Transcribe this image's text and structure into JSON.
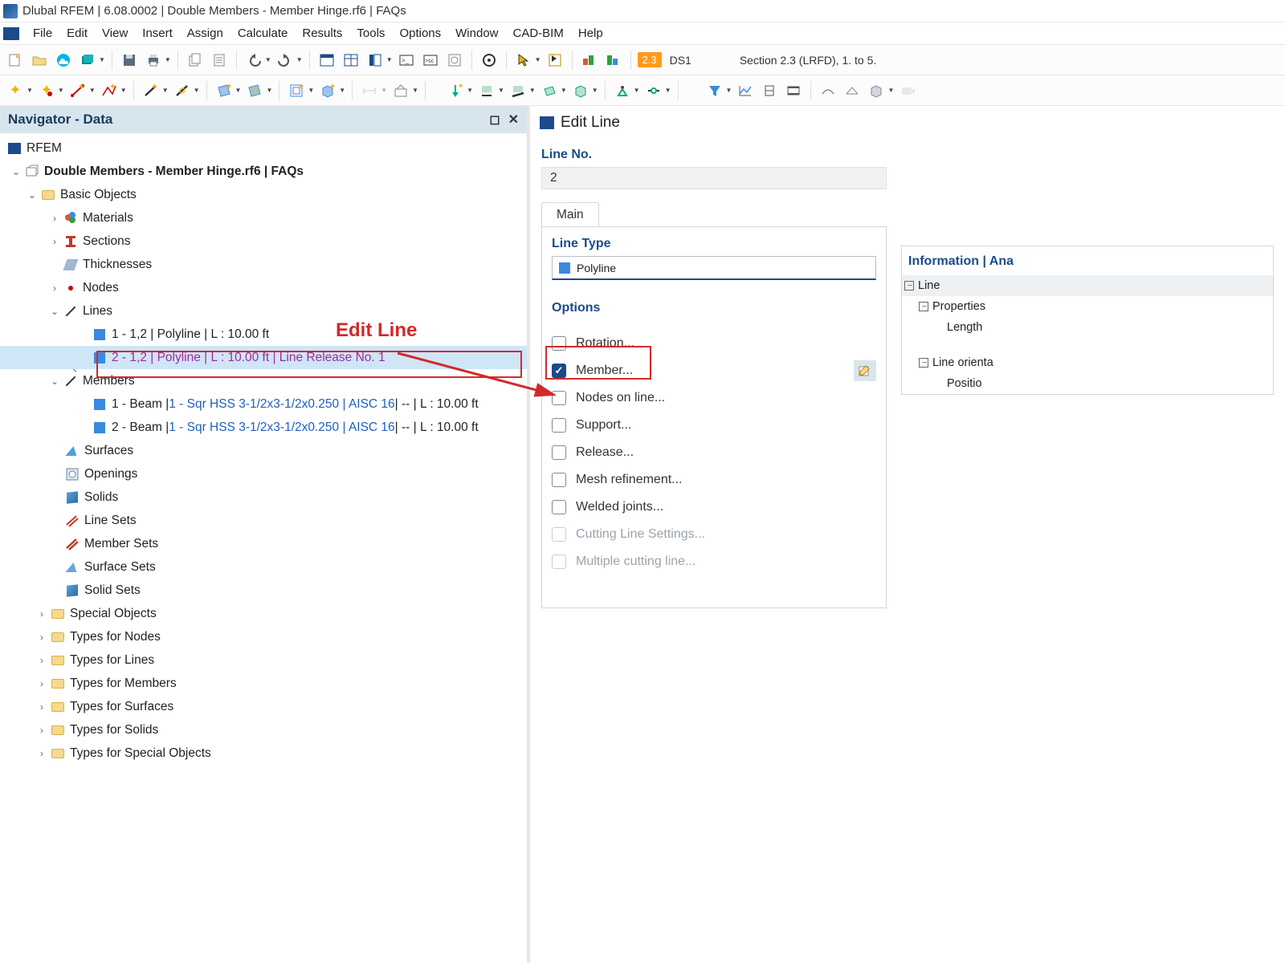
{
  "title": "Dlubal RFEM | 6.08.0002 | Double Members - Member Hinge.rf6 | FAQs",
  "menu": [
    "File",
    "Edit",
    "View",
    "Insert",
    "Assign",
    "Calculate",
    "Results",
    "Tools",
    "Options",
    "Window",
    "CAD-BIM",
    "Help"
  ],
  "toolbar1": {
    "badge": "2.3",
    "ds": "DS1",
    "section_text": "Section 2.3 (LRFD), 1. to 5."
  },
  "navigator": {
    "title": "Navigator - Data",
    "root": "RFEM",
    "model": "Double Members - Member Hinge.rf6 | FAQs",
    "basic_objects": "Basic Objects",
    "items": {
      "materials": "Materials",
      "sections": "Sections",
      "thicknesses": "Thicknesses",
      "nodes": "Nodes",
      "lines": "Lines",
      "members": "Members",
      "surfaces": "Surfaces",
      "openings": "Openings",
      "solids": "Solids",
      "line_sets": "Line Sets",
      "member_sets": "Member Sets",
      "surface_sets": "Surface Sets",
      "solid_sets": "Solid Sets"
    },
    "lines_children": {
      "l1": "1 - 1,2 | Polyline | L : 10.00 ft",
      "l2": "2 - 1,2 | Polyline | L : 10.00 ft | Line Release No. 1"
    },
    "members_children": {
      "m1_pre": "1 - Beam | ",
      "m1_link": "1 - Sqr HSS 3-1/2x3-1/2x0.250 | AISC 16",
      "m1_post": " | -- | L : 10.00 ft",
      "m2_pre": "2 - Beam | ",
      "m2_link": "1 - Sqr HSS 3-1/2x3-1/2x0.250 | AISC 16",
      "m2_post": " | -- | L : 10.00 ft"
    },
    "groups2": {
      "special": "Special Objects",
      "types_nodes": "Types for Nodes",
      "types_lines": "Types for Lines",
      "types_members": "Types for Members",
      "types_surfaces": "Types for Surfaces",
      "types_solids": "Types for Solids",
      "types_special": "Types for Special Objects"
    },
    "annotation": "Edit Line"
  },
  "edit": {
    "title": "Edit Line",
    "line_no_label": "Line No.",
    "line_no_value": "2",
    "tab_main": "Main",
    "line_type_label": "Line Type",
    "line_type_value": "Polyline",
    "options_label": "Options",
    "opts": {
      "rotation": "Rotation...",
      "member": "Member...",
      "nodes_on_line": "Nodes on line...",
      "support": "Support...",
      "release": "Release...",
      "mesh": "Mesh refinement...",
      "welded": "Welded joints...",
      "cutting": "Cutting Line Settings...",
      "multi": "Multiple cutting line..."
    },
    "info": {
      "header": "Information | Ana",
      "line": "Line",
      "properties": "Properties",
      "length": "Length",
      "orient": "Line orienta",
      "position": "Positio"
    }
  }
}
